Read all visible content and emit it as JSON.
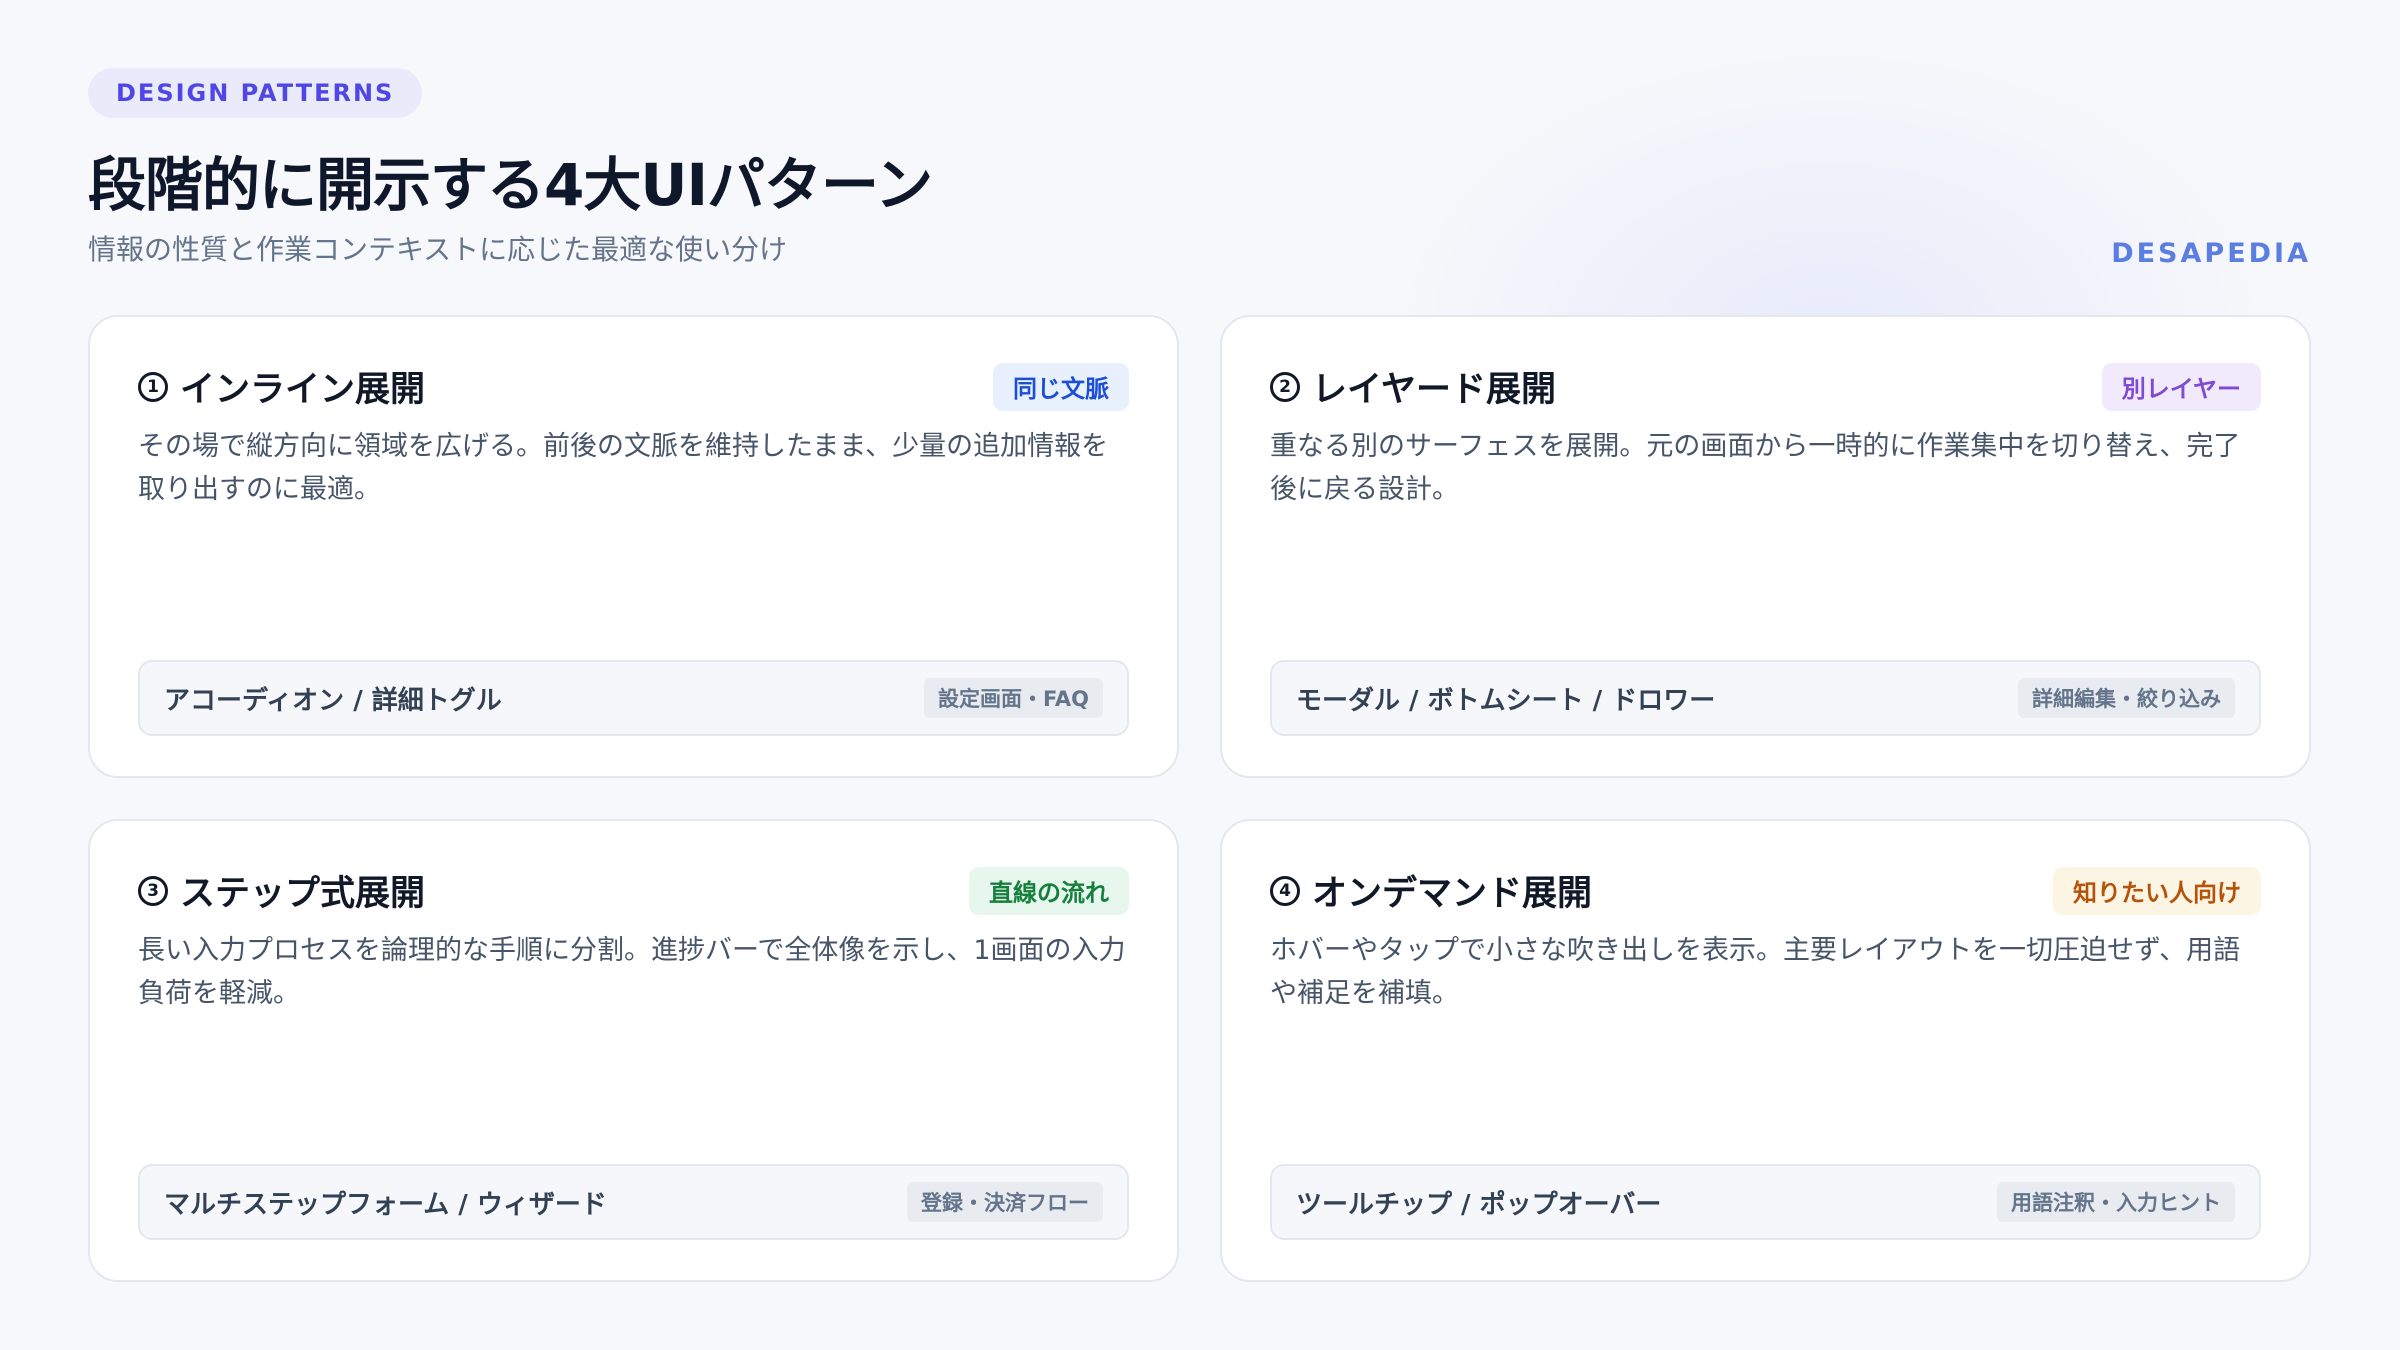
{
  "header": {
    "eyebrow": "DESIGN PATTERNS",
    "title": "段階的に開示する4大UIパターン",
    "subtitle": "情報の性質と作業コンテキストに応じた最適な使い分け",
    "brand": "DESAPEDIA"
  },
  "cards": [
    {
      "number": "1",
      "title": "インライン展開",
      "tag": "同じ文脈",
      "tag_color": "#1d4ed8",
      "tag_bg": "#e8f0fd",
      "description": "その場で縦方向に領域を広げる。前後の文脈を維持したまま、少量の追加情報を取り出すのに最適。",
      "example": "アコーディオン / 詳細トグル",
      "use_case": "設定画面・FAQ"
    },
    {
      "number": "2",
      "title": "レイヤード展開",
      "tag": "別レイヤー",
      "tag_color": "#7e4ad6",
      "tag_bg": "#f1eafc",
      "description": "重なる別のサーフェスを展開。元の画面から一時的に作業集中を切り替え、完了後に戻る設計。",
      "example": "モーダル / ボトムシート / ドロワー",
      "use_case": "詳細編集・絞り込み"
    },
    {
      "number": "3",
      "title": "ステップ式展開",
      "tag": "直線の流れ",
      "tag_color": "#15803d",
      "tag_bg": "#e7f7ee",
      "description": "長い入力プロセスを論理的な手順に分割。進捗バーで全体像を示し、1画面の入力負荷を軽減。",
      "example": "マルチステップフォーム / ウィザード",
      "use_case": "登録・決済フロー"
    },
    {
      "number": "4",
      "title": "オンデマンド展開",
      "tag": "知りたい人向け",
      "tag_color": "#b45309",
      "tag_bg": "#fdf5e4",
      "description": "ホバーやタップで小さな吹き出しを表示。主要レイアウトを一切圧迫せず、用語や補足を補填。",
      "example": "ツールチップ / ポップオーバー",
      "use_case": "用語注釈・入力ヒント"
    }
  ]
}
